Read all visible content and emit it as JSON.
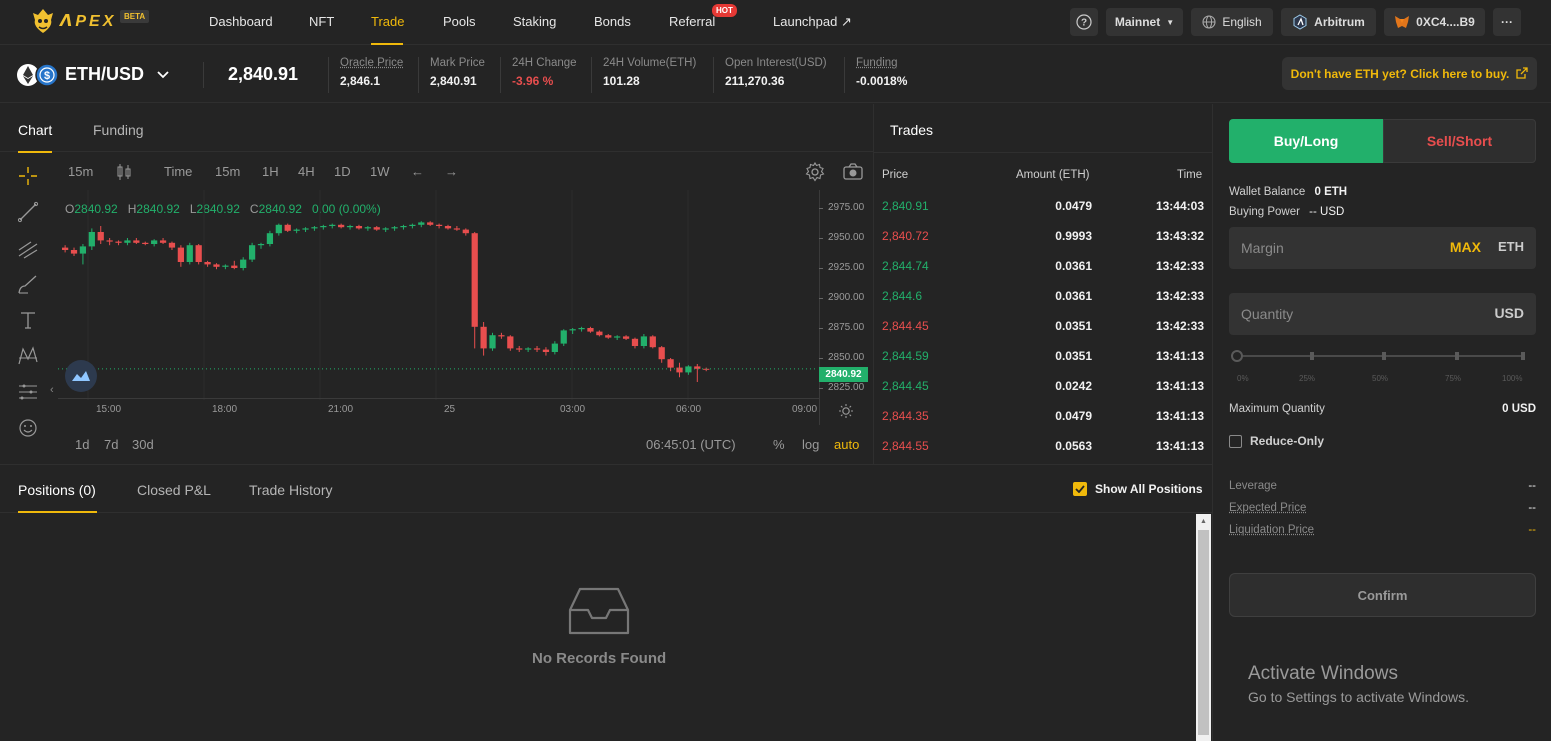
{
  "brand": {
    "name": "ᐱPEX",
    "badge": "BETA"
  },
  "nav": {
    "items": [
      {
        "label": "Dashboard"
      },
      {
        "label": "NFT"
      },
      {
        "label": "Trade"
      },
      {
        "label": "Pools"
      },
      {
        "label": "Staking"
      },
      {
        "label": "Bonds"
      },
      {
        "label": "Referral"
      },
      {
        "label": "Launchpad ↗"
      }
    ],
    "hot_badge": "HOT",
    "active": "Trade"
  },
  "topbar": {
    "help": "?",
    "network": "Mainnet",
    "language": "English",
    "chain": "Arbitrum",
    "wallet": "0XC4....B9",
    "more": "···"
  },
  "ticker": {
    "pair": "ETH/USD",
    "price": "2,840.91",
    "stats": [
      {
        "label": "Oracle Price",
        "value": "2,846.1",
        "underlined": true
      },
      {
        "label": "Mark Price",
        "value": "2,840.91"
      },
      {
        "label": "24H Change",
        "value": "-3.96 %",
        "negative": true
      },
      {
        "label": "24H Volume(ETH)",
        "value": "101.28"
      },
      {
        "label": "Open Interest(USD)",
        "value": "211,270.36"
      },
      {
        "label": "Funding",
        "value": "-0.0018%",
        "underlined": true
      }
    ],
    "buy_eth": "Don't have ETH yet? Click here to buy."
  },
  "chart_tabs": [
    {
      "label": "Chart"
    },
    {
      "label": "Funding"
    }
  ],
  "chart_toolbar": {
    "interval": "15m",
    "time": "Time",
    "intervals": [
      "15m",
      "1H",
      "4H",
      "1D",
      "1W"
    ],
    "undo": "←",
    "redo": "→"
  },
  "ohlc": {
    "o_label": "O",
    "o": "2840.92",
    "h_label": "H",
    "h": "2840.92",
    "l_label": "L",
    "l": "2840.92",
    "c_label": "C",
    "c": "2840.92",
    "change": "0.00 (0.00%)"
  },
  "chart_footer": {
    "ranges": [
      "1d",
      "7d",
      "30d"
    ],
    "clock": "06:45:01 (UTC)",
    "pct": "%",
    "log": "log",
    "auto": "auto"
  },
  "chart_data": {
    "type": "candlestick",
    "y_ticks": [
      "2975.00",
      "2950.00",
      "2925.00",
      "2900.00",
      "2875.00",
      "2850.00",
      "2825.00"
    ],
    "x_ticks": [
      "15:00",
      "18:00",
      "21:00",
      "25",
      "03:00",
      "06:00",
      "09:00"
    ],
    "ylim": [
      2815,
      2990
    ],
    "last_price_label": "2840.92",
    "candles": [
      [
        2942,
        2944,
        2938,
        2940
      ],
      [
        2940,
        2942,
        2935,
        2937
      ],
      [
        2937,
        2945,
        2928,
        2943
      ],
      [
        2943,
        2958,
        2940,
        2955
      ],
      [
        2955,
        2960,
        2945,
        2948
      ],
      [
        2948,
        2950,
        2944,
        2947
      ],
      [
        2947,
        2948,
        2944,
        2946
      ],
      [
        2946,
        2950,
        2944,
        2948
      ],
      [
        2948,
        2950,
        2945,
        2946
      ],
      [
        2946,
        2947,
        2944,
        2945
      ],
      [
        2945,
        2949,
        2943,
        2948
      ],
      [
        2948,
        2950,
        2945,
        2946
      ],
      [
        2946,
        2947,
        2940,
        2942
      ],
      [
        2942,
        2944,
        2926,
        2930
      ],
      [
        2930,
        2946,
        2928,
        2944
      ],
      [
        2944,
        2945,
        2928,
        2930
      ],
      [
        2930,
        2931,
        2926,
        2928
      ],
      [
        2928,
        2929,
        2924,
        2926
      ],
      [
        2926,
        2928,
        2924,
        2927
      ],
      [
        2927,
        2931,
        2924,
        2925
      ],
      [
        2925,
        2934,
        2923,
        2932
      ],
      [
        2932,
        2946,
        2930,
        2944
      ],
      [
        2944,
        2946,
        2941,
        2945
      ],
      [
        2945,
        2956,
        2943,
        2954
      ],
      [
        2954,
        2962,
        2952,
        2961
      ],
      [
        2961,
        2962,
        2955,
        2956
      ],
      [
        2956,
        2958,
        2954,
        2957
      ],
      [
        2957,
        2959,
        2955,
        2958
      ],
      [
        2958,
        2960,
        2956,
        2959
      ],
      [
        2959,
        2961,
        2957,
        2960
      ],
      [
        2960,
        2962,
        2958,
        2961
      ],
      [
        2961,
        2962,
        2958,
        2959
      ],
      [
        2959,
        2961,
        2957,
        2960
      ],
      [
        2960,
        2961,
        2957,
        2958
      ],
      [
        2958,
        2960,
        2956,
        2959
      ],
      [
        2959,
        2960,
        2956,
        2957
      ],
      [
        2957,
        2959,
        2955,
        2958
      ],
      [
        2958,
        2960,
        2956,
        2959
      ],
      [
        2959,
        2961,
        2957,
        2960
      ],
      [
        2960,
        2962,
        2958,
        2961
      ],
      [
        2961,
        2964,
        2959,
        2963
      ],
      [
        2963,
        2964,
        2960,
        2961
      ],
      [
        2961,
        2962,
        2958,
        2960
      ],
      [
        2960,
        2961,
        2957,
        2958
      ],
      [
        2958,
        2960,
        2956,
        2957
      ],
      [
        2957,
        2958,
        2952,
        2954
      ],
      [
        2954,
        2955,
        2858,
        2876
      ],
      [
        2876,
        2880,
        2852,
        2858
      ],
      [
        2858,
        2871,
        2856,
        2869
      ],
      [
        2869,
        2871,
        2866,
        2868
      ],
      [
        2868,
        2869,
        2856,
        2858
      ],
      [
        2858,
        2860,
        2855,
        2857
      ],
      [
        2857,
        2859,
        2855,
        2858
      ],
      [
        2858,
        2860,
        2855,
        2857
      ],
      [
        2857,
        2859,
        2852,
        2855
      ],
      [
        2855,
        2864,
        2853,
        2862
      ],
      [
        2862,
        2874,
        2860,
        2873
      ],
      [
        2873,
        2875,
        2870,
        2874
      ],
      [
        2874,
        2876,
        2872,
        2875
      ],
      [
        2875,
        2876,
        2871,
        2872
      ],
      [
        2872,
        2873,
        2868,
        2869
      ],
      [
        2869,
        2870,
        2866,
        2867
      ],
      [
        2867,
        2869,
        2865,
        2868
      ],
      [
        2868,
        2869,
        2865,
        2866
      ],
      [
        2866,
        2867,
        2858,
        2860
      ],
      [
        2860,
        2870,
        2858,
        2868
      ],
      [
        2868,
        2869,
        2858,
        2859
      ],
      [
        2859,
        2860,
        2846,
        2849
      ],
      [
        2849,
        2850,
        2839,
        2842
      ],
      [
        2842,
        2846,
        2834,
        2838
      ],
      [
        2838,
        2844,
        2836,
        2843
      ],
      [
        2843,
        2845,
        2830,
        2841
      ],
      [
        2841,
        2842,
        2839,
        2840.9
      ]
    ]
  },
  "trades": {
    "title": "Trades",
    "headers": {
      "price": "Price",
      "amount": "Amount (ETH)",
      "time": "Time"
    },
    "rows": [
      {
        "price": "2,840.91",
        "amount": "0.0479",
        "time": "13:44:03",
        "side": "buy"
      },
      {
        "price": "2,840.72",
        "amount": "0.9993",
        "time": "13:43:32",
        "side": "sell"
      },
      {
        "price": "2,844.74",
        "amount": "0.0361",
        "time": "13:42:33",
        "side": "buy"
      },
      {
        "price": "2,844.6",
        "amount": "0.0361",
        "time": "13:42:33",
        "side": "buy"
      },
      {
        "price": "2,844.45",
        "amount": "0.0351",
        "time": "13:42:33",
        "side": "sell"
      },
      {
        "price": "2,844.59",
        "amount": "0.0351",
        "time": "13:41:13",
        "side": "buy"
      },
      {
        "price": "2,844.45",
        "amount": "0.0242",
        "time": "13:41:13",
        "side": "buy"
      },
      {
        "price": "2,844.35",
        "amount": "0.0479",
        "time": "13:41:13",
        "side": "sell"
      },
      {
        "price": "2,844.55",
        "amount": "0.0563",
        "time": "13:41:13",
        "side": "sell"
      }
    ]
  },
  "positions": {
    "tabs": [
      {
        "label": "Positions (0)"
      },
      {
        "label": "Closed P&L"
      },
      {
        "label": "Trade History"
      }
    ],
    "show_all": "Show All Positions",
    "empty": "No Records Found"
  },
  "order": {
    "buy": "Buy/Long",
    "sell": "Sell/Short",
    "wallet_balance_label": "Wallet Balance",
    "wallet_balance": "0 ETH",
    "buying_power_label": "Buying Power",
    "buying_power": "-- USD",
    "margin_placeholder": "Margin",
    "margin_max": "MAX",
    "margin_unit": "ETH",
    "quantity_placeholder": "Quantity",
    "quantity_unit": "USD",
    "slider_labels": [
      "0%",
      "25%",
      "50%",
      "75%",
      "100%"
    ],
    "slider_value": 0,
    "max_qty_label": "Maximum Quantity",
    "max_qty": "0 USD",
    "reduce_only": "Reduce-Only",
    "leverage_label": "Leverage",
    "leverage": "--",
    "expected_price_label": "Expected Price",
    "expected_price": "--",
    "liq_price_label": "Liquidation Price",
    "liq_price": "--",
    "confirm": "Confirm"
  },
  "watermark": {
    "line1": "Activate Windows",
    "line2": "Go to Settings to activate Windows."
  },
  "colors": {
    "accent": "#f0b90b",
    "up": "#22b06b",
    "down": "#e84e4e",
    "bg": "#242424"
  }
}
